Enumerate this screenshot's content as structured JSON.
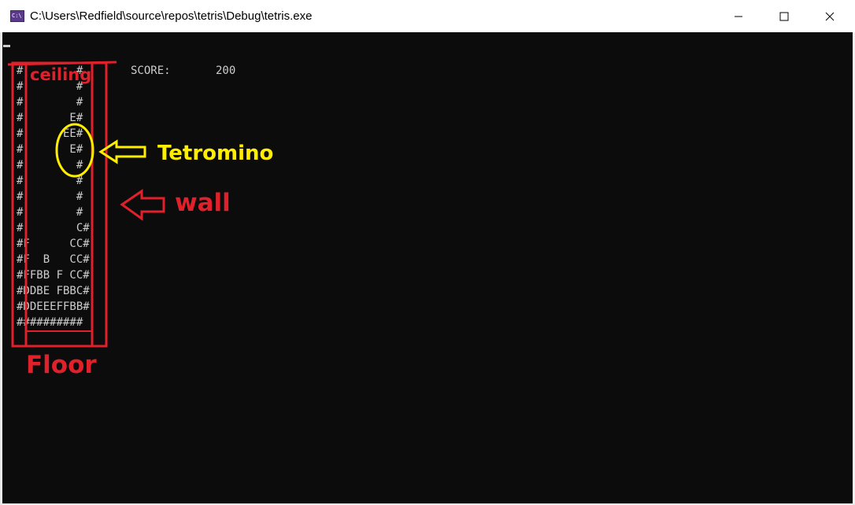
{
  "window": {
    "title": "C:\\Users\\Redfield\\source\\repos\\tetris\\Debug\\tetris.exe",
    "icon_text": "C:\\",
    "controls": [
      "minimize-icon",
      "maximize-icon",
      "close-icon"
    ]
  },
  "console": {
    "score_label": "SCORE:",
    "score_value": "200",
    "board_rows": [
      "#        #",
      "#        #",
      "#        #",
      "#       E#",
      "#      EE#",
      "#       E#",
      "#        #",
      "#        #",
      "#        #",
      "#        #",
      "#        C#",
      "#F      CC#",
      "#F  B   CC#",
      "#FFBB F CC#",
      "#DDBE FBBC#",
      "#DDEEEFFBB#",
      "##########"
    ]
  },
  "annotations": {
    "ceiling": "ceiling",
    "tetromino": "Tetromino",
    "wall": "wall",
    "floor": "Floor"
  },
  "colors": {
    "console_bg": "#0c0c0c",
    "console_text": "#cccccc",
    "annotation_red": "#e0202a",
    "annotation_yellow": "#ffee00"
  }
}
